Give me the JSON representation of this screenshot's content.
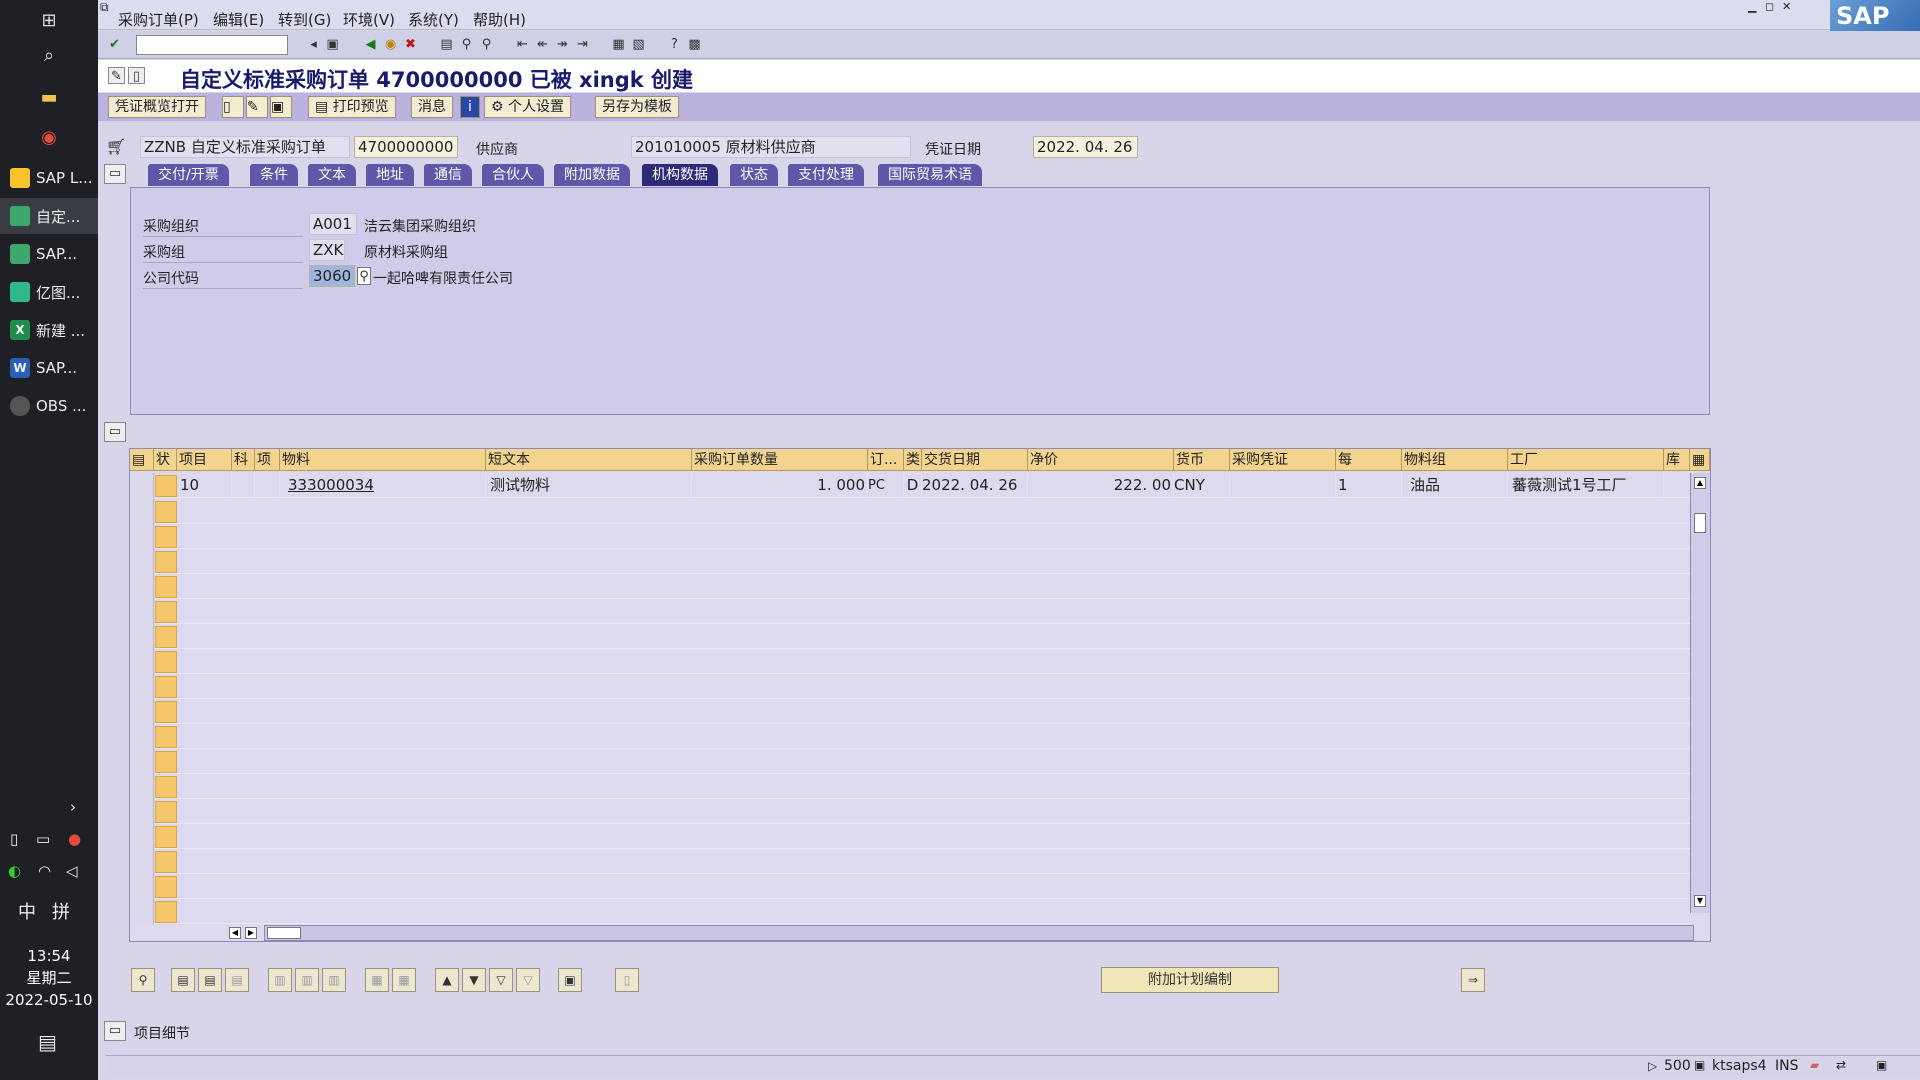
{
  "taskbar": {
    "apps": [
      {
        "label": "SAP L...",
        "color": "#f7c52b"
      },
      {
        "label": "自定...",
        "color": "#3da86c"
      },
      {
        "label": "SAP...",
        "color": "#3da86c"
      },
      {
        "label": "亿图...",
        "color": "#2fb88a"
      },
      {
        "label": "新建 ...",
        "color": "#1d8f4a"
      },
      {
        "label": "SAP...",
        "color": "#2b5fb5"
      },
      {
        "label": "OBS ...",
        "color": "#555"
      }
    ],
    "ime_lang": "中",
    "ime_mode": "拼",
    "clock_time": "13:54",
    "clock_day": "星期二",
    "clock_date": "2022-05-10"
  },
  "menu": {
    "items": [
      "采购订单(P)",
      "编辑(E)",
      "转到(G)",
      "环境(V)",
      "系统(Y)",
      "帮助(H)"
    ]
  },
  "title": "自定义标准采购订单 4700000000 已被 xingk 创建",
  "app_toolbar": {
    "overview": "凭证概览打开",
    "print_preview": "打印预览",
    "messages": "消息",
    "personal_settings": "个人设置",
    "save_as_template": "另存为模板"
  },
  "header": {
    "doc_type": "ZZNB 自定义标准采购订单",
    "po_number": "4700000000",
    "vendor_label": "供应商",
    "vendor_value": "201010005 原材料供应商",
    "doc_date_label": "凭证日期",
    "doc_date_value": "2022. 04. 26"
  },
  "tabs": [
    "交付/开票",
    "条件",
    "文本",
    "地址",
    "通信",
    "合伙人",
    "附加数据",
    "机构数据",
    "状态",
    "支付处理",
    "国际贸易术语"
  ],
  "active_tab": "机构数据",
  "org_data": {
    "purch_org_label": "采购组织",
    "purch_org_code": "A001",
    "purch_org_name": "洁云集团采购组织",
    "purch_group_label": "采购组",
    "purch_group_code": "ZXK",
    "purch_group_name": "原材料采购组",
    "company_code_label": "公司代码",
    "company_code": "3060",
    "company_name": "一起哈啤有限责任公司"
  },
  "items_table": {
    "headers": [
      "状",
      "项目",
      "科",
      "项",
      "物料",
      "短文本",
      "采购订单数量",
      "订...",
      "类",
      "交货日期",
      "净价",
      "货币",
      "采购凭证",
      "每",
      "物料组",
      "工厂",
      "库"
    ],
    "rows": [
      {
        "item": "10",
        "material": "333000034",
        "short_text": "测试物料",
        "quantity": "1. 000",
        "unit": "PC",
        "category": "D",
        "delivery_date": "2022. 04. 26",
        "net_price": "222. 00",
        "currency": "CNY",
        "per": "1",
        "material_group": "油品",
        "plant": "蕃薇测试1号工厂"
      }
    ]
  },
  "bottom": {
    "schedule_button": "附加计划编制",
    "item_detail": "项目细节"
  },
  "statusbar": {
    "client": "500",
    "server": "ktsaps4",
    "mode": "INS"
  },
  "logo": "SAP"
}
